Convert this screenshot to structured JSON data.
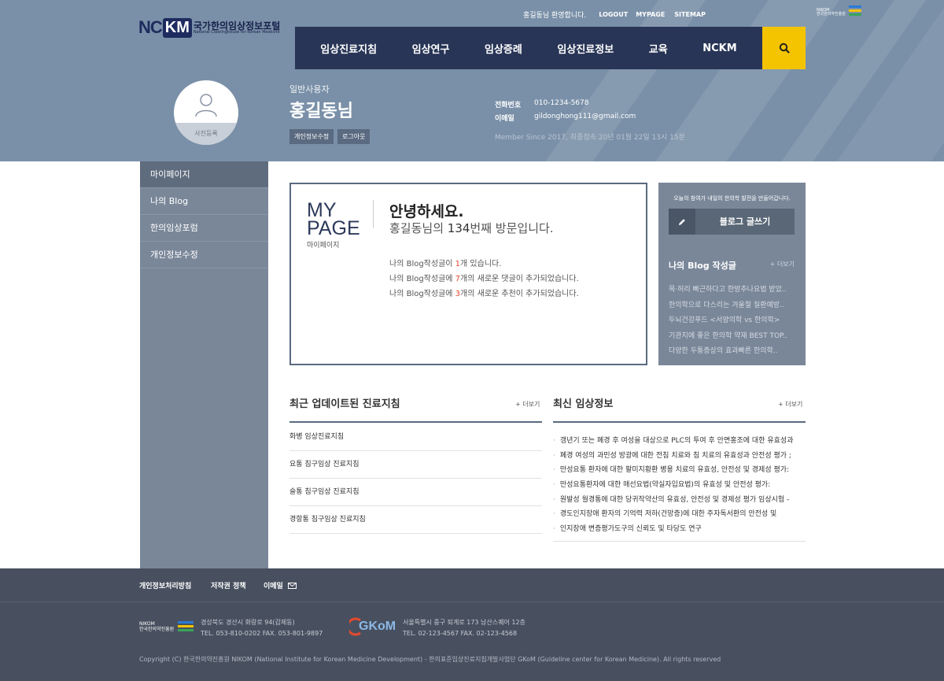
{
  "header": {
    "logo": {
      "mark_left": "NC",
      "mark_right": "KM",
      "title": "국가한의임상정보포털",
      "subtitle": "National Clearinghouse for Korean Medicine"
    },
    "top_menu": {
      "welcome": "홍길동님 환영합니다.",
      "logout": "LOGOUT",
      "mypage": "MYPAGE",
      "sitemap": "SITEMAP"
    },
    "nikom": {
      "line1": "NIKOM",
      "line2": "한국한의약진흥원"
    },
    "nav": [
      "임상진료지침",
      "임상연구",
      "임상증례",
      "임상진료정보",
      "교육",
      "NCKM"
    ],
    "search_icon": "search-icon"
  },
  "profile": {
    "photo_label": "사진등록",
    "user_type": "일반사용자",
    "name": "홍길동님",
    "edit_button": "개인정보수정",
    "logout_button": "로그아웃",
    "phone_label": "전화번호",
    "phone": "010-1234-5678",
    "email_label": "이메일",
    "email": "gildonghong111@gmail.com",
    "member_since": "Member Since 2017, 최종접속 20년 01월 22일 13시 15분"
  },
  "sidebar": {
    "items": [
      {
        "label": "마이페이지",
        "active": true
      },
      {
        "label": "나의 Blog",
        "active": false
      },
      {
        "label": "한의임상포럼",
        "active": false
      },
      {
        "label": "개인정보수정",
        "active": false
      }
    ]
  },
  "mypage": {
    "title_line1": "MY",
    "title_line2": "PAGE",
    "subtitle": "마이페이지",
    "greeting": "안녕하세요.",
    "visit_pre": "홍길동님의 ",
    "visit_count": "134",
    "visit_post": "번째 방문입니다.",
    "lines": [
      {
        "pre": "나의 Blog작성글이 ",
        "num": "1",
        "post": "개 있습니다."
      },
      {
        "pre": "나의 Blog작성글에 ",
        "num": "7",
        "post": "개의 새로운 댓글이 추가되었습니다."
      },
      {
        "pre": "나의 Blog작성글에 ",
        "num": "3",
        "post": "개의 새로운 추천이 추가되었습니다."
      }
    ]
  },
  "blog_panel": {
    "message": "오늘의 참여가 내일의 한의학 발전을 만들어갑니다.",
    "write_button": "블로그 글쓰기",
    "write_icon": "pencil-icon",
    "heading": "나의 Blog 작성글",
    "more": "+ 더보기",
    "posts": [
      "목·허리 빠근하다고 한방추나요법 받았..",
      "한의학으로 다스리는 겨울철 질환예방..",
      "두뇌건강푸드 <서양의학 vs 한의학>",
      "기관지에 좋은 한의학 약재 BEST TOP..",
      "다양한 두통증상의 효과빠른 한의학.."
    ]
  },
  "guidelines": {
    "heading": "최근 업데이트된 진료지침",
    "more": "+ 더보기",
    "items": [
      "화병 임상진료지침",
      "요통 침구임상 진료지침",
      "슬통 침구임상 진료지침",
      "경항통 침구임상 진료지침"
    ]
  },
  "clinical_info": {
    "heading": "최신 임상정보",
    "more": "+ 더보기",
    "items": [
      "갱년기 또는 폐경 후 여성을 대상으로 PLC의 투여 후 안면홍조에 대한 유효성과",
      "폐경 여성의 과민성 방광에 대한 전침 치료와 침 치료의 유효성과 안전성 평가 ;",
      "만성요통 환자에 대한 팔미지황환 병용 치료의 유효성, 안전성 및 경제성 평가:",
      "만성요통환자에 대한 매선요법(약실자입요법)의 유효성 및 안전성 평가:",
      "원발성 월경통에 대한 당귀작약산의 유효성, 안전성 및 경제성 평가 임상시험 -",
      "경도인지장애 환자의 기억력 저하(건망증)에 대한 주자독서환의 안전성 및",
      "인지장애 변증평가도구의 신뢰도 및 타당도 연구"
    ]
  },
  "footer": {
    "links": [
      "개인정보처리방침",
      "저작권 정책",
      "이메일"
    ],
    "email_icon": "mail-icon",
    "org1": {
      "logo_line1": "NIKOM",
      "logo_line2": "한국한의약진흥원",
      "address": "경상북도 경산시 화랑로 94(갑제동)",
      "contact": "TEL. 053-810-0202  FAX. 053-801-9897"
    },
    "org2": {
      "logo_text": "GKoM",
      "address": "서울특별시 중구 퇴계로 173 남산스퀘어 12층",
      "contact": "TEL. 02-123-4567  FAX. 02-123-4568"
    },
    "copyright": "Copyright (C) 한국한의약진흥원 NIKOM (National Institute for Korean Medicine Development) - 한의표준임상진료지침개발사업단 GKoM (Guideline center for Korean Medicine). All rights reserved"
  },
  "colors": {
    "nav_bg": "#283556",
    "search_bg": "#f5c400",
    "hero_bg": "#7a90a8",
    "sidebar_bg": "#7a8799",
    "footer_bg": "#48505f",
    "accent_red": "#e6492d"
  }
}
